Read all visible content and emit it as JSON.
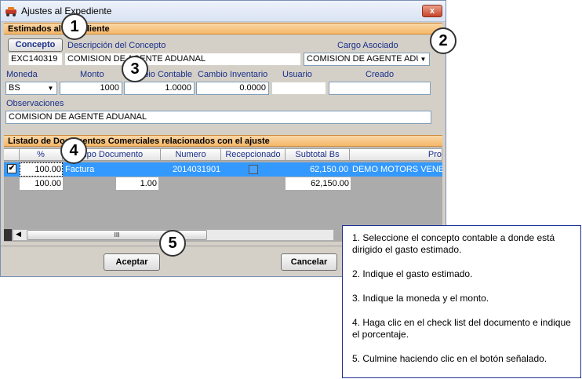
{
  "window": {
    "title": "Ajustes al Expediente",
    "close_label": "x"
  },
  "estimados": {
    "header": "Estimados al Expediente",
    "concepto_label": "Concepto",
    "descripcion_label": "Descripción del Concepto",
    "cargo_label": "Cargo Asociado",
    "concepto_value": "EXC140319",
    "descripcion_value": "COMISION DE AGENTE ADUANAL",
    "cargo_value": "COMISION DE AGENTE ADUA",
    "moneda_label": "Moneda",
    "monto_label": "Monto",
    "cambio_contable_label": "Cambio Contable",
    "cambio_inventario_label": "Cambio Inventario",
    "usuario_label": "Usuario",
    "creado_label": "Creado",
    "moneda_value": "BS",
    "monto_value": "1000",
    "cambio_contable_value": "1.0000",
    "cambio_inventario_value": "0.0000",
    "usuario_value": "",
    "creado_value": "",
    "observaciones_label": "Observaciones",
    "observaciones_value": "COMISION DE AGENTE ADUANAL"
  },
  "listado": {
    "header": "Listado de Documentos Comerciales relacionados con el ajuste",
    "columns": [
      "%",
      "Tipo Documento",
      "Numero",
      "Recepcionado",
      "Subtotal Bs",
      "Pro"
    ],
    "row": {
      "checked": true,
      "percent": "100.00",
      "tipo": "Factura",
      "numero": "2014031901",
      "subtotal": "62,150.00",
      "proveedor": "DEMO MOTORS VENEZ"
    },
    "totals": {
      "percent": "100.00",
      "factor": "1.00",
      "subtotal": "62,150.00"
    },
    "scroll_grip": "III"
  },
  "buttons": {
    "aceptar": "Aceptar",
    "cancelar": "Cancelar"
  },
  "callouts": [
    "1",
    "2",
    "3",
    "4",
    "5"
  ],
  "notes": [
    "1. Seleccione el concepto contable a donde está dirigido el gasto estimado.",
    "2. Indique el gasto estimado.",
    "3. Indique la moneda y el monto.",
    "4. Haga clic en el check list del documento e indique el porcentaje.",
    "5. Culmine haciendo clic en el botón señalado."
  ]
}
